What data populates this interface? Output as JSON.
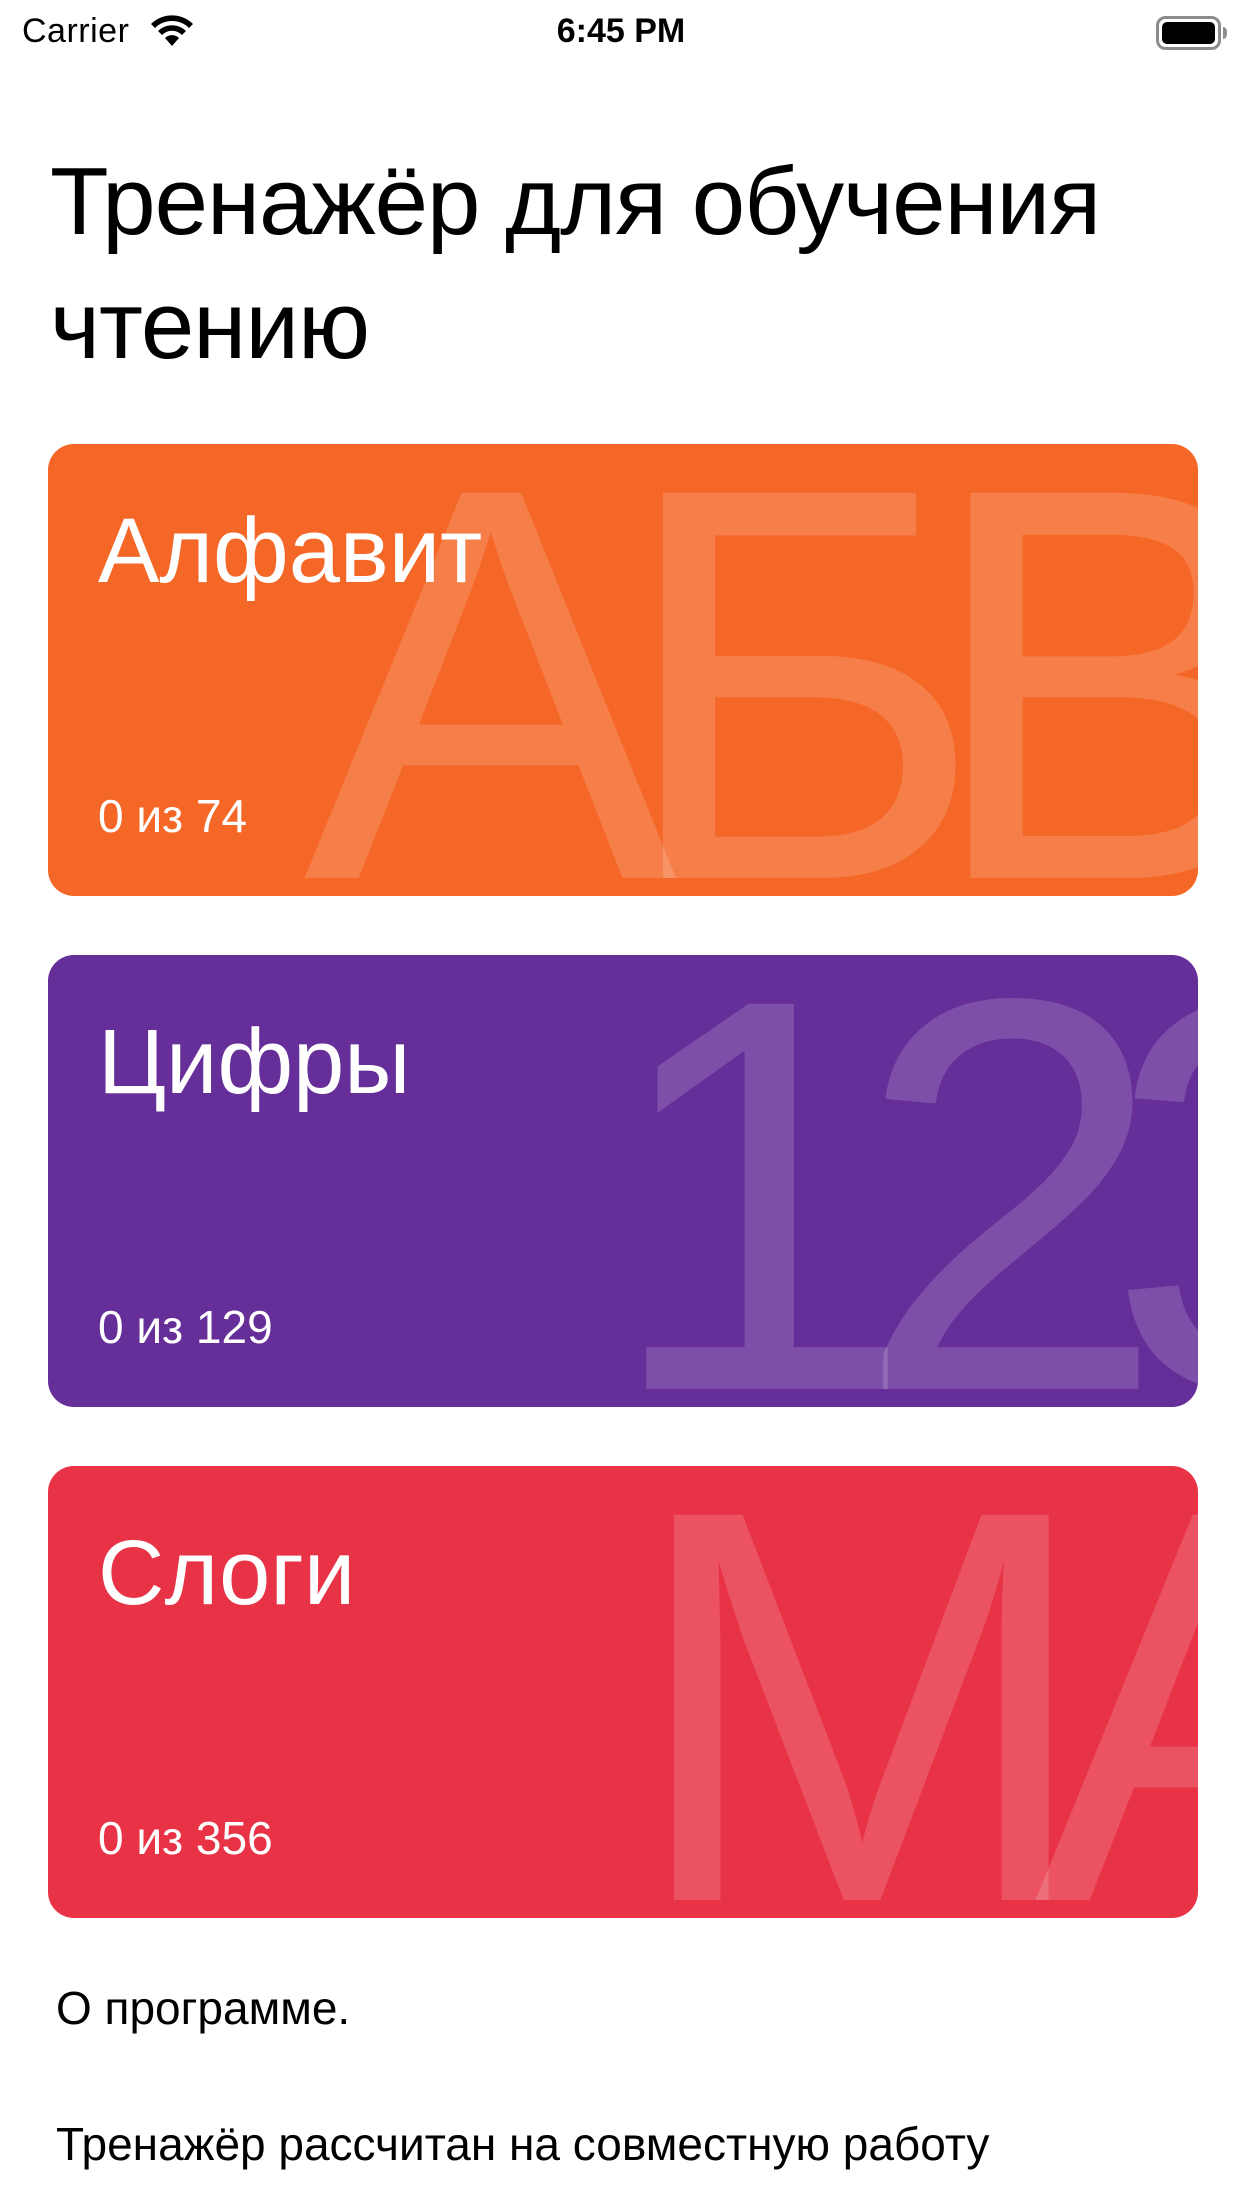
{
  "status_bar": {
    "carrier": "Carrier",
    "time": "6:45 PM",
    "icons": [
      "wifi-icon",
      "battery-icon"
    ]
  },
  "page": {
    "title": "Тренажёр для обучения чтению"
  },
  "cards": [
    {
      "title": "Алфавит",
      "progress": "0 из 74",
      "background_glyphs": "АБВ",
      "color": "#f56727"
    },
    {
      "title": "Цифры",
      "progress": "0 из 129",
      "background_glyphs": "123",
      "color": "#652e98"
    },
    {
      "title": "Слоги",
      "progress": "0 из 356",
      "background_glyphs": "МА",
      "color": "#e83346"
    }
  ],
  "about": {
    "heading": "О программе.",
    "text": "Тренажёр рассчитан на совместную работу"
  }
}
